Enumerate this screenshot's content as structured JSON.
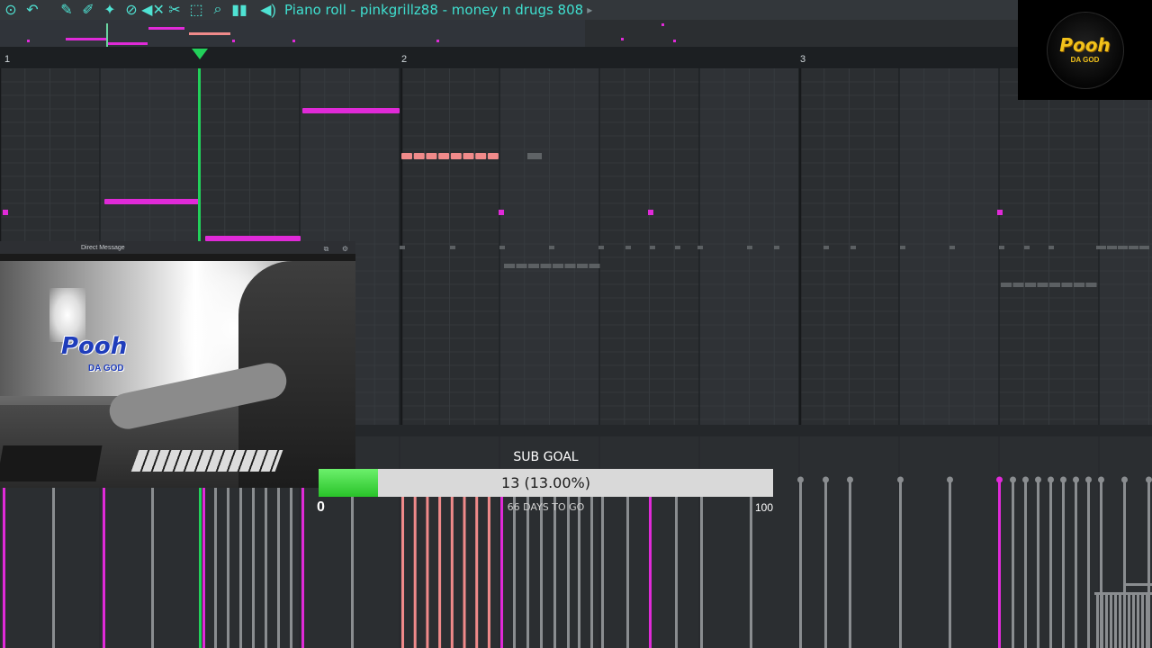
{
  "toolbar": {
    "icons": [
      "menu-icon",
      "undo-icon",
      "pencil-icon",
      "paint-icon",
      "stamp-icon",
      "delete-icon",
      "mute-icon",
      "slice-icon",
      "select-icon",
      "zoom-icon",
      "play-icon"
    ],
    "speaker_icon": "speaker-icon",
    "title": "Piano roll - pinkgrillz88 - money n drugs 808",
    "title_arrow": "▸"
  },
  "ruler": {
    "bars": [
      "1",
      "2",
      "3"
    ]
  },
  "colors": {
    "grid_bg": "#2b2e31",
    "note_magenta": "#e02ad8",
    "note_salmon": "#f08a8a",
    "note_gray": "#5c6063",
    "playhead": "#22d05a",
    "velocity_gray": "#8a8d90"
  },
  "stream_logo": {
    "text": "Pooh",
    "sub": "DA GOD"
  },
  "webcam": {
    "title": "Direct Message",
    "watermark": "Pooh",
    "watermark_sub": "DA GOD"
  },
  "sub_goal": {
    "label": "SUB GOAL",
    "progress_text": "13 (13.00%)",
    "progress_fraction": 0.13,
    "min": "0",
    "max": "100",
    "days_text": "66 DAYS TO GO"
  }
}
